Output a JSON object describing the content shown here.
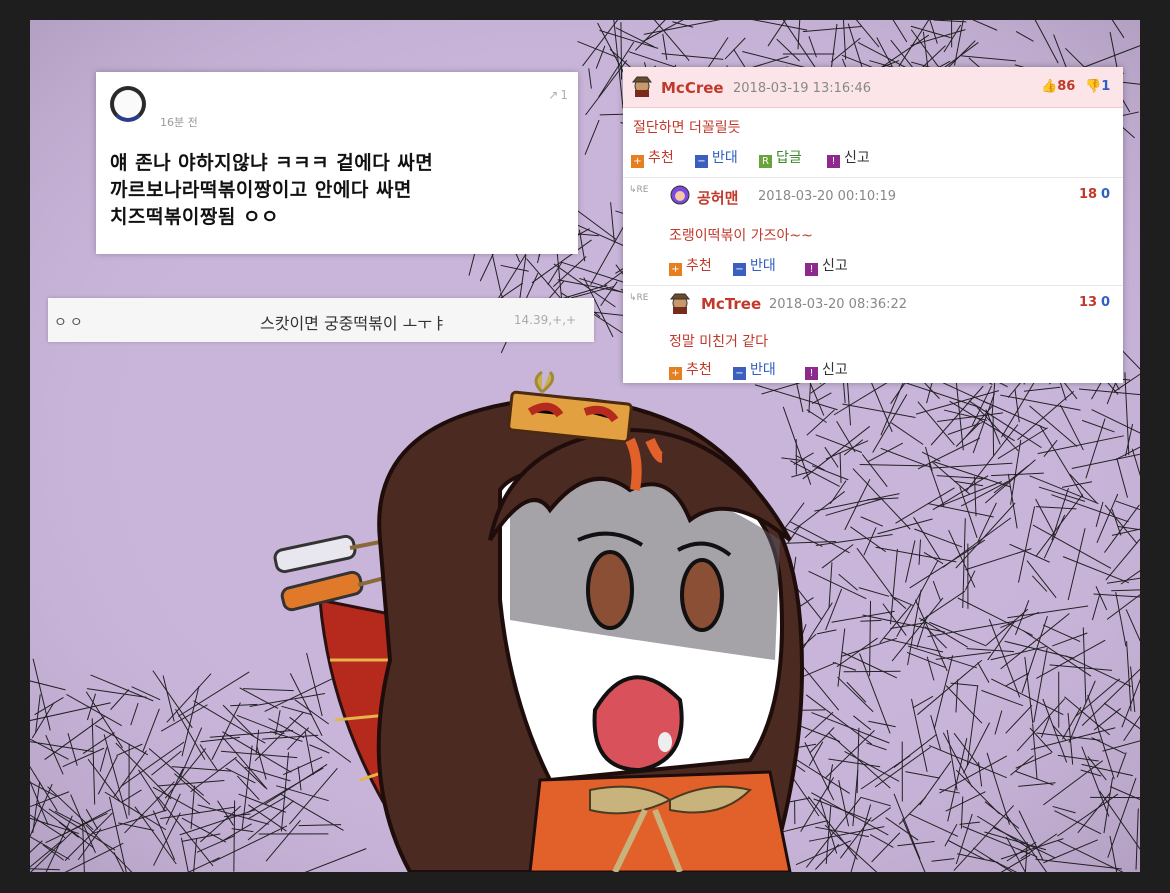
{
  "left_post": {
    "time": "16분 전",
    "share_count": "1",
    "body_lines": [
      "얘 존나 야하지않냐 ㅋㅋㅋ 겉에다 싸면",
      "까르보나라떡볶이짱이고 안에다 싸면",
      "치즈떡볶이짱됨 ㅇㅇ"
    ]
  },
  "strip": {
    "dots": "ㅇㅇ",
    "text": "스캇이면 궁중떡볶이 ㅗㅜㅑ",
    "meta": "14.39,+,+"
  },
  "comments": {
    "main": {
      "user": "McCree",
      "date": "2018-03-19 13:16:46",
      "up": "86",
      "down": "1",
      "text": "절단하면 더꼴릴듯",
      "buttons": {
        "recommend": "추천",
        "oppose": "반대",
        "reply": "답글",
        "report": "신고"
      }
    },
    "replies": [
      {
        "tag": "RE",
        "user": "공허맨",
        "date": "2018-03-20 00:10:19",
        "up": "18",
        "down": "0",
        "text": "조랭이떡볶이 가즈아~~",
        "buttons": {
          "recommend": "추천",
          "oppose": "반대",
          "report": "신고"
        }
      },
      {
        "tag": "RE",
        "user": "McTree",
        "date": "2018-03-20 08:36:22",
        "up": "13",
        "down": "0",
        "text": "정말 미친거 같다",
        "buttons": {
          "recommend": "추천",
          "oppose": "반대",
          "report": "신고"
        }
      }
    ]
  },
  "colors": {
    "bg_purple": "#c8b4d8",
    "accent_red": "#c0392b",
    "up_vote": "#c0392b",
    "down_vote": "#2e5fc1"
  }
}
